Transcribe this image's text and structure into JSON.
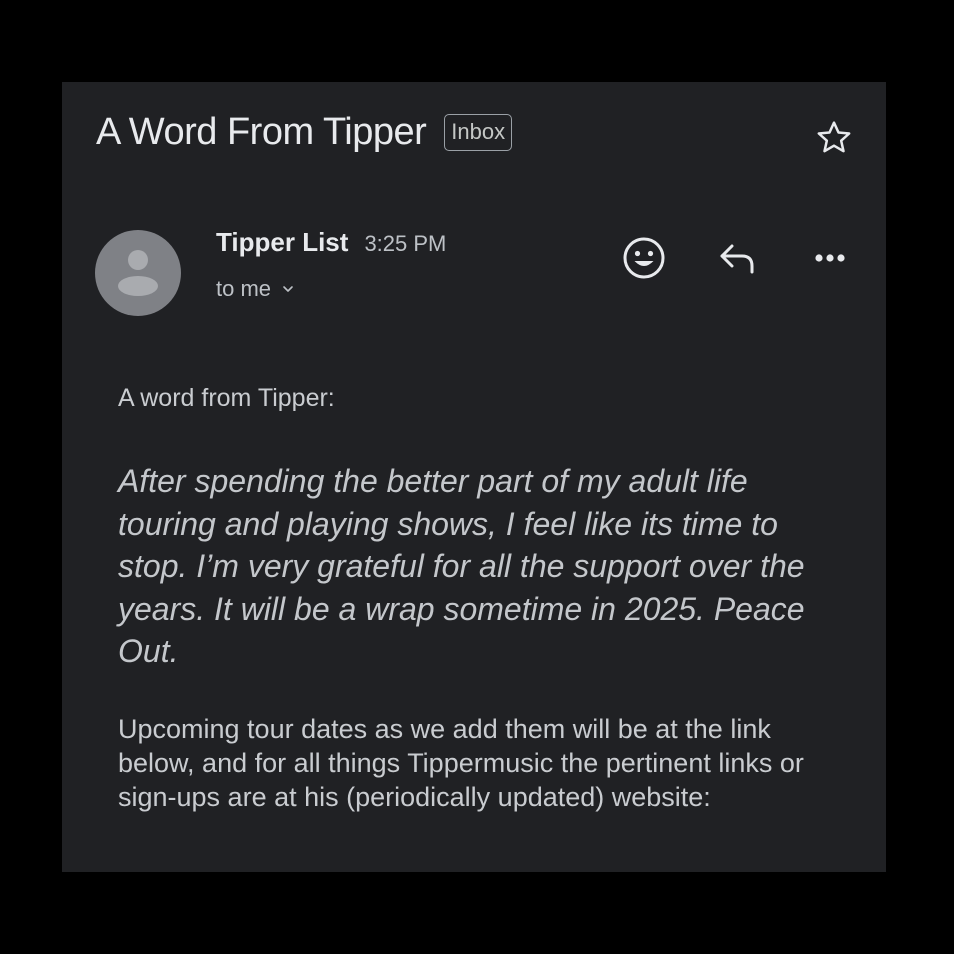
{
  "email": {
    "subject": "A Word From Tipper",
    "label": "Inbox",
    "sender_name": "Tipper List",
    "time": "3:25 PM",
    "recipient": "to me",
    "greeting": "A word from Tipper:",
    "quote": "After spending the better part of my adult life touring and playing shows, I feel like its time to stop. I’m very grateful for all the support over the years. It will be a wrap sometime in 2025. Peace Out.",
    "tour_text": "Upcoming tour dates as we add them will be at the link below, and for all things Tippermusic the pertinent links or sign-ups are at his (periodically updated) website:"
  },
  "icons": {
    "star": "star-outline-icon",
    "avatar": "person-icon",
    "emoji": "smiley-icon",
    "reply": "reply-icon",
    "more": "more-horizontal-icon",
    "recipient_details": "chevron-down-icon"
  },
  "colors": {
    "background": "#202124",
    "outer_background": "#000000",
    "text_primary": "#e8eaed",
    "text_secondary": "#bdc1c6",
    "avatar_bg": "#7f8186"
  }
}
